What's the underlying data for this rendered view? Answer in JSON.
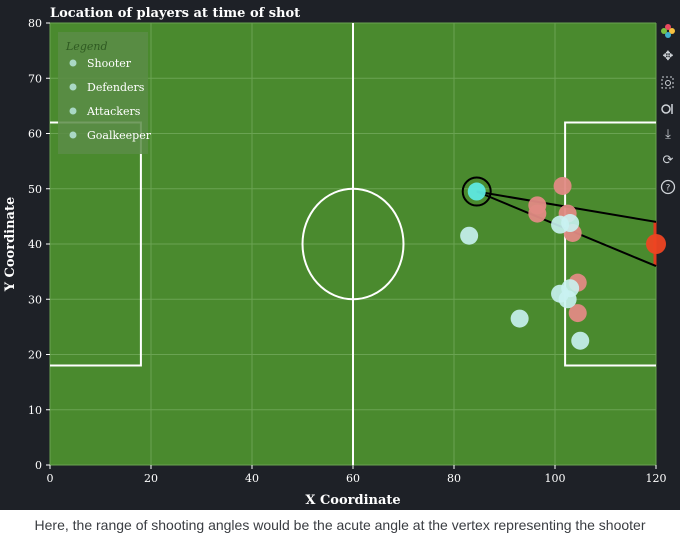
{
  "chart_data": {
    "type": "scatter",
    "title": "Location of players at time of shot",
    "xlabel": "X Coordinate",
    "ylabel": "Y Coordinate",
    "xlim": [
      0,
      120
    ],
    "ylim": [
      0,
      80
    ],
    "xticks": [
      0,
      20,
      40,
      60,
      80,
      100,
      120
    ],
    "yticks": [
      0,
      10,
      20,
      30,
      40,
      50,
      60,
      70,
      80
    ],
    "grid": true,
    "legend_title": "Legend",
    "legend_position": "top-left",
    "series": [
      {
        "name": "Shooter",
        "color": "#5ee8e0",
        "points": [
          [
            84.5,
            49.5
          ]
        ]
      },
      {
        "name": "Defenders",
        "color": "#e08a84",
        "points": [
          [
            101.5,
            50.5
          ],
          [
            96.5,
            47.0
          ],
          [
            96.5,
            45.5
          ],
          [
            102.5,
            45.5
          ],
          [
            103.5,
            42.0
          ],
          [
            104.5,
            33.0
          ],
          [
            104.5,
            27.5
          ]
        ]
      },
      {
        "name": "Attackers",
        "color": "#c9f2f2",
        "points": [
          [
            83.0,
            41.5
          ],
          [
            101.0,
            43.5
          ],
          [
            103.0,
            43.8
          ],
          [
            101.0,
            31.0
          ],
          [
            102.5,
            30.0
          ],
          [
            103.0,
            32.0
          ],
          [
            93.0,
            26.5
          ],
          [
            105.0,
            22.5
          ]
        ]
      },
      {
        "name": "Goalkeeper",
        "color": "#ee4422",
        "points": [
          [
            120.0,
            40.0
          ]
        ]
      }
    ],
    "annotations": {
      "shooter_angle_lines": [
        [
          [
            84.5,
            49.5
          ],
          [
            120,
            44
          ]
        ],
        [
          [
            84.5,
            49.5
          ],
          [
            120,
            36
          ]
        ]
      ]
    }
  },
  "toolbar": {
    "icons": [
      "bokeh-logo-icon",
      "pan-icon",
      "box-zoom-icon",
      "wheel-zoom-icon",
      "save-icon",
      "reset-icon",
      "help-icon"
    ]
  },
  "caption": "Here, the range of shooting angles would be the acute angle at the vertex representing the shooter"
}
